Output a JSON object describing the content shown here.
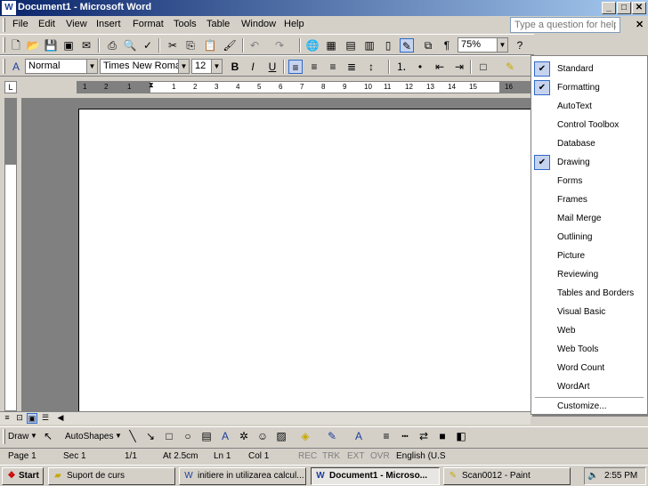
{
  "window": {
    "title": "Document1 - Microsoft Word",
    "min_label": "_",
    "max_label": "□",
    "close_label": "✕"
  },
  "menu": {
    "items": [
      "File",
      "Edit",
      "View",
      "Insert",
      "Format",
      "Tools",
      "Table",
      "Window",
      "Help"
    ],
    "help_placeholder": "Type a question for help",
    "close_doc_label": "✕"
  },
  "standard_toolbar": {
    "zoom": "75%"
  },
  "formatting_toolbar": {
    "style": "Normal",
    "font": "Times New Roman",
    "size": "12"
  },
  "ruler": {
    "ticks": [
      "1",
      "2",
      "1",
      "1",
      "2",
      "3",
      "4",
      "5",
      "6",
      "7",
      "8",
      "9",
      "10",
      "11",
      "12",
      "13",
      "14",
      "15",
      "16"
    ]
  },
  "context_menu": {
    "items": [
      {
        "label": "Standard",
        "checked": true
      },
      {
        "label": "Formatting",
        "checked": true
      },
      {
        "label": "AutoText",
        "checked": false
      },
      {
        "label": "Control Toolbox",
        "checked": false
      },
      {
        "label": "Database",
        "checked": false
      },
      {
        "label": "Drawing",
        "checked": true
      },
      {
        "label": "Forms",
        "checked": false
      },
      {
        "label": "Frames",
        "checked": false
      },
      {
        "label": "Mail Merge",
        "checked": false
      },
      {
        "label": "Outlining",
        "checked": false
      },
      {
        "label": "Picture",
        "checked": false
      },
      {
        "label": "Reviewing",
        "checked": false
      },
      {
        "label": "Tables and Borders",
        "checked": false
      },
      {
        "label": "Visual Basic",
        "checked": false
      },
      {
        "label": "Web",
        "checked": false
      },
      {
        "label": "Web Tools",
        "checked": false
      },
      {
        "label": "Word Count",
        "checked": false
      },
      {
        "label": "WordArt",
        "checked": false
      }
    ],
    "customize": "Customize..."
  },
  "drawing_toolbar": {
    "draw_label": "Draw",
    "autoshapes_label": "AutoShapes"
  },
  "status": {
    "page": "Page 1",
    "sec": "Sec 1",
    "pages": "1/1",
    "at": "At 2.5cm",
    "ln": "Ln 1",
    "col": "Col 1",
    "rec": "REC",
    "trk": "TRK",
    "ext": "EXT",
    "ovr": "OVR",
    "lang": "English (U.S"
  },
  "taskbar": {
    "start": "Start",
    "tasks": [
      "Suport de curs",
      "initiere in utilizarea calcul...",
      "Document1 - Microso...",
      "Scan0012 - Paint"
    ],
    "clock": "2:55 PM"
  }
}
